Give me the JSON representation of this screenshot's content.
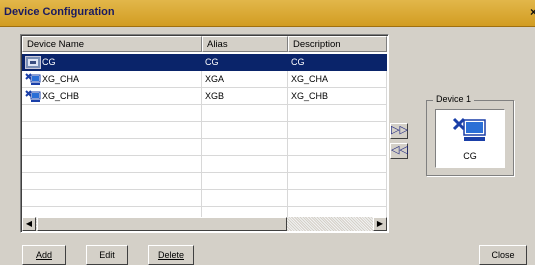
{
  "window": {
    "title": "Device Configuration",
    "close_glyph": "×"
  },
  "table": {
    "columns": [
      "Device Name",
      "Alias",
      "Description"
    ],
    "rows": [
      {
        "name": "CG",
        "alias": "CG",
        "description": "CG",
        "icon": "cg-device-icon",
        "selected": true
      },
      {
        "name": "XG_CHA",
        "alias": "XGA",
        "description": "XG_CHA",
        "icon": "xg-device-icon",
        "selected": false
      },
      {
        "name": "XG_CHB",
        "alias": "XGB",
        "description": "XG_CHB",
        "icon": "xg-device-icon",
        "selected": false
      }
    ]
  },
  "move_right_glyph": "▷▷",
  "move_left_glyph": "◁◁",
  "group": {
    "label": "Device 1",
    "device_name": "CG",
    "device_icon": "cg-device-icon"
  },
  "buttons": {
    "add": "Add",
    "edit": "Edit",
    "delete": "Delete",
    "close": "Close"
  },
  "colors": {
    "title_bar": "#d9a52f",
    "selection": "#0a246a",
    "arrow": "#1a237e"
  }
}
